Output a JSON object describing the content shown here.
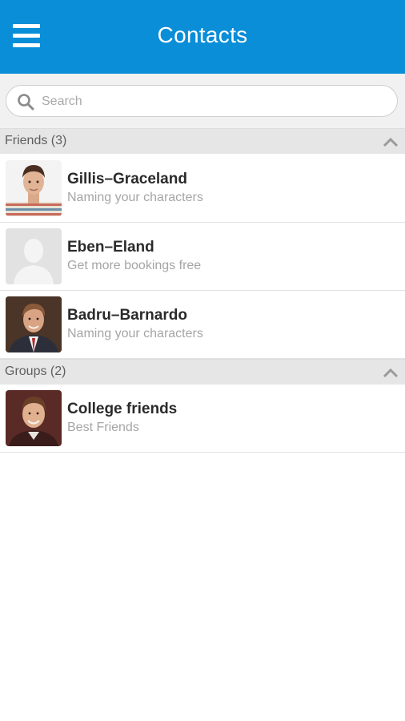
{
  "header": {
    "menu_icon": "hamburger-menu-icon",
    "title": "Contacts",
    "background": "#0a8ed8"
  },
  "search": {
    "icon": "search-icon",
    "placeholder": "Search",
    "value": ""
  },
  "sections": [
    {
      "label": "Friends (3)",
      "expanded": true,
      "items": [
        {
          "name": "Gillis–Graceland",
          "subtitle": "Naming your characters",
          "avatar": "young-man-striped-shirt"
        },
        {
          "name": "Eben–Eland",
          "subtitle": "Get more bookings free",
          "avatar": "placeholder-silhouette"
        },
        {
          "name": "Badru–Barnardo",
          "subtitle": "Naming your characters",
          "avatar": "man-in-suit"
        }
      ]
    },
    {
      "label": "Groups (2)",
      "expanded": true,
      "items": [
        {
          "name": "College friends",
          "subtitle": "Best Friends",
          "avatar": "smiling-man"
        }
      ]
    }
  ]
}
